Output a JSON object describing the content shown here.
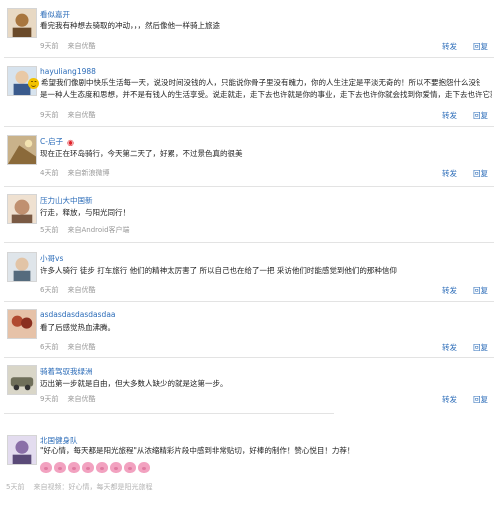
{
  "actions": {
    "forward": "转发",
    "reply": "回复"
  },
  "posts": [
    {
      "user": "看似嘉开",
      "text": "看完我有种想去骑取的冲动，，，然后像他一样骑上旅途",
      "time": "9天前",
      "source": "来自优酷",
      "avatar_color": "#a8763f"
    },
    {
      "user": "hayuliang1988",
      "text": "希望我们像剧中快乐生活每一天，说没时间没钱的人，只能说你骨子里没有魄力，你的人生注定是平淡无奇的！所以不要抱怨什么没钱没时间，这",
      "text2": "是一种人生态度和思想，并不是有钱人的生活享受。说走就走，走下去也许就是你的事业，走下去也许你就会找到你爱情，走下去也许它就能让你……",
      "time": "9天前",
      "source": "来自优酷",
      "avatar_color": "#3a5a8c"
    },
    {
      "user": "C-启子",
      "text": "现在正在环岛骑行，今天第二天了，好累，不过景色真的很美",
      "time": "4天前",
      "source": "来自新浪微博",
      "avatar_color": "#8b6a3a"
    },
    {
      "user": "压力山大中国新",
      "text": "行走，释放，与阳光同行！",
      "time": "5天前",
      "source": "来自Android客户端",
      "avatar_color": "#c09070"
    },
    {
      "user": "小哥vs",
      "text": "许多人骑行 徒步 打车旅行 他们的精神太厉害了 所以自己也在给了一把 采访他们时能感觉到他们的那种信仰",
      "time": "6天前",
      "source": "来自优酷",
      "avatar_color": "#556b7d"
    },
    {
      "user": "asdasdasdasdasdaa",
      "text": "看了后感觉热血沸腾。",
      "time": "6天前",
      "source": "来自优酷",
      "avatar_color": "#b04a30"
    },
    {
      "user": "骑着驾驭我绿洲",
      "text": "迈出第一步就是自由，但大多数人缺少的就是这第一步。",
      "time": "9天前",
      "source": "来自优酷",
      "avatar_color": "#6f6f5a"
    },
    {
      "user": "北国健身队",
      "text": "\"好心情，每天都是阳光旅程\"从浓缩精彩片段中感到非常贴切，好棒的制作！赞心悦目！力荐！",
      "time": "5天前",
      "source": "来自视频：好心情，每天都是阳光旅程",
      "avatar_color": "#8a6fa8"
    }
  ]
}
